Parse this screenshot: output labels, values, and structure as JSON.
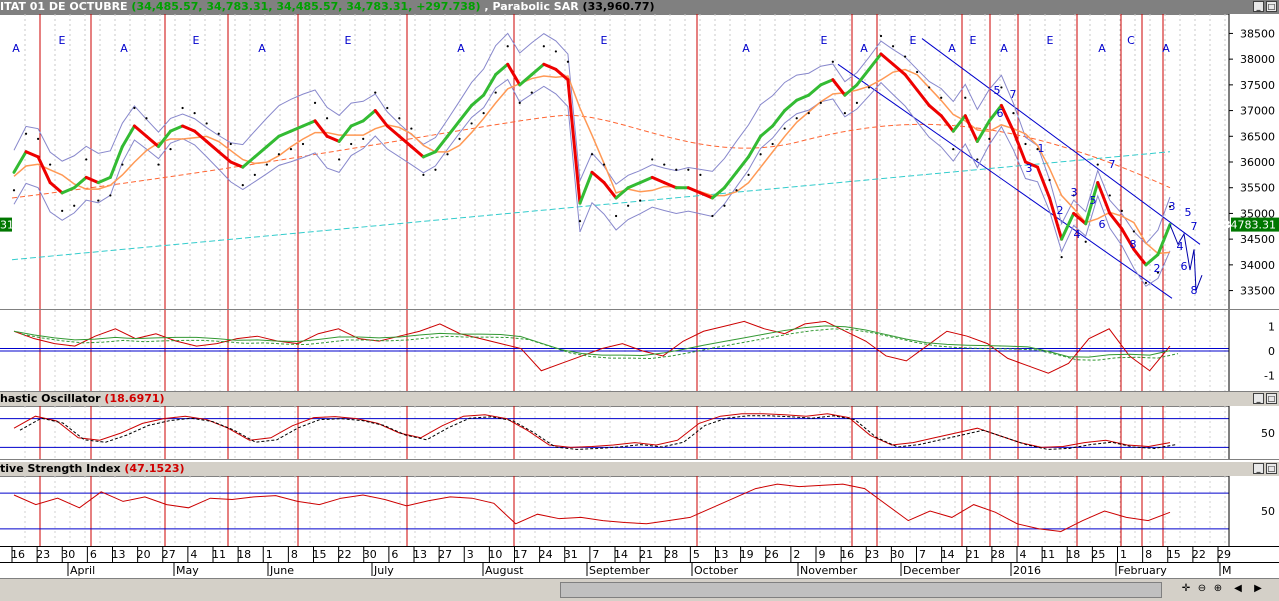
{
  "main_pane": {
    "title_name": "ITAT 01 DE OCTUBRE",
    "title_values": "(34,485.57, 34,783.31, 34,485.57, 34,783.31, +297.738)",
    "title_indicator": "Parabolic SAR",
    "title_indicator_value": "(33,960.77)",
    "last_price_label": "34783.31",
    "left_price_label": "31"
  },
  "stoch_pane": {
    "title_name": "hastic Oscillator",
    "title_value": "(18.6971)"
  },
  "rsi_pane": {
    "title_name": "tive Strength Index",
    "title_value": "(47.1523)"
  },
  "colors": {
    "bull": "#33bb33",
    "bear": "#ee0000",
    "ma_fast": "#ff9955",
    "ma_slow_dashed": "#ff6633",
    "trend_line": "#33cccc",
    "bands": "#8888cc",
    "channel": "#0000cc",
    "vlines": "#cc0000"
  },
  "icons": {
    "minimize": "minimize-icon",
    "maximize": "maximize-icon",
    "scroll_left": "arrow-left-icon",
    "scroll_right": "arrow-right-icon",
    "zoom_in": "zoom-in-icon",
    "zoom_out": "zoom-out-icon"
  },
  "chart_data": [
    {
      "type": "line",
      "title": "",
      "xlabel": "",
      "ylabel": "",
      "ylim": [
        33200,
        38800
      ],
      "y_ticks": [
        33500,
        34000,
        34500,
        35000,
        35500,
        36000,
        36500,
        37000,
        37500,
        38000,
        38500
      ],
      "date_ticks": [
        "16",
        "23",
        "30",
        "6",
        "13",
        "20",
        "27",
        "4",
        "11",
        "18",
        "1",
        "8",
        "15",
        "22",
        "30",
        "6",
        "13",
        "27",
        "3",
        "10",
        "17",
        "24",
        "31",
        "7",
        "14",
        "21",
        "28",
        "5",
        "13",
        "19",
        "26",
        "2",
        "9",
        "16",
        "23",
        "30",
        "7",
        "14",
        "21",
        "28",
        "4",
        "11",
        "18",
        "25",
        "1",
        "8",
        "15",
        "22",
        "29"
      ],
      "month_labels": [
        "April",
        "May",
        "June",
        "July",
        "August",
        "September",
        "October",
        "November",
        "December",
        "2016",
        "February",
        "M"
      ],
      "cycle_labels": [
        "A",
        "E",
        "A",
        "E",
        "A",
        "E",
        "A",
        "E",
        "A",
        "E",
        "A",
        "E",
        "A",
        "E",
        "A",
        "E",
        "A",
        "C",
        "A"
      ],
      "wave_labels": [
        "5",
        "7",
        "6",
        "1",
        "3",
        "2",
        "3",
        "5",
        "4",
        "6",
        "7",
        "8",
        "2",
        "3",
        "4",
        "5",
        "7",
        "6",
        "8"
      ],
      "series": [
        {
          "values": [
            35800,
            36200,
            36100,
            35600,
            35400,
            35500,
            35700,
            35600,
            35700,
            36300,
            36700,
            36500,
            36300,
            36600,
            36700,
            36600,
            36400,
            36200,
            36000,
            35900,
            36100,
            36300,
            36500,
            36600,
            36700,
            36800,
            36500,
            36400,
            36700,
            36800,
            37000,
            36700,
            36500,
            36300,
            36100,
            36200,
            36500,
            36800,
            37100,
            37300,
            37700,
            37900,
            37500,
            37700,
            37900,
            37800,
            37600,
            35200,
            35800,
            35600,
            35300,
            35500,
            35600,
            35700,
            35600,
            35500,
            35500,
            35400,
            35300,
            35500,
            35800,
            36100,
            36500,
            36700,
            37000,
            37200,
            37300,
            37500,
            37600,
            37300,
            37500,
            37800,
            38100,
            37900,
            37700,
            37400,
            37100,
            36900,
            36600,
            36900,
            36400,
            36800,
            37100,
            36600,
            36000,
            35900,
            35300,
            34500,
            35000,
            34800,
            35600,
            35000,
            34700,
            34300,
            34000,
            34200,
            34783
          ]
        }
      ]
    },
    {
      "type": "line",
      "title": "",
      "ylim": [
        -1.5,
        1.5
      ],
      "y_ticks": [
        -1,
        0,
        1
      ],
      "series": [
        {
          "values": [
            0.8,
            0.5,
            0.3,
            0.2,
            0.6,
            0.9,
            0.5,
            0.7,
            0.4,
            0.2,
            0.3,
            0.5,
            0.6,
            0.4,
            0.3,
            0.7,
            0.9,
            0.5,
            0.4,
            0.6,
            0.8,
            1.1,
            0.7,
            0.5,
            0.3,
            0.1,
            -0.8,
            -0.5,
            -0.2,
            0.1,
            0.3,
            0.0,
            -0.2,
            0.4,
            0.8,
            1.0,
            1.2,
            0.9,
            0.7,
            1.1,
            1.2,
            0.8,
            0.4,
            -0.2,
            -0.4,
            0.2,
            0.8,
            0.6,
            0.3,
            -0.3,
            -0.6,
            -0.9,
            -0.5,
            0.5,
            0.9,
            -0.2,
            -0.8,
            0.2
          ]
        }
      ]
    },
    {
      "type": "line",
      "title": "",
      "ylim": [
        0,
        100
      ],
      "y_ticks": [
        50
      ],
      "series": [
        {
          "values": [
            60,
            85,
            75,
            40,
            35,
            50,
            70,
            80,
            85,
            78,
            60,
            35,
            40,
            65,
            82,
            84,
            80,
            70,
            50,
            40,
            65,
            85,
            88,
            80,
            55,
            25,
            20,
            22,
            25,
            30,
            25,
            35,
            70,
            85,
            90,
            90,
            88,
            85,
            90,
            82,
            45,
            25,
            30,
            40,
            50,
            60,
            45,
            30,
            20,
            22,
            30,
            35,
            25,
            22,
            30
          ]
        }
      ]
    },
    {
      "type": "line",
      "title": "",
      "ylim": [
        0,
        100
      ],
      "y_ticks": [
        50
      ],
      "series": [
        {
          "values": [
            75,
            60,
            70,
            55,
            80,
            65,
            72,
            60,
            55,
            70,
            68,
            72,
            74,
            65,
            60,
            70,
            75,
            68,
            58,
            66,
            72,
            70,
            62,
            30,
            45,
            38,
            40,
            35,
            32,
            30,
            35,
            40,
            55,
            70,
            85,
            92,
            88,
            90,
            92,
            85,
            60,
            35,
            50,
            40,
            60,
            48,
            30,
            22,
            18,
            35,
            50,
            40,
            35,
            48
          ]
        }
      ]
    }
  ]
}
